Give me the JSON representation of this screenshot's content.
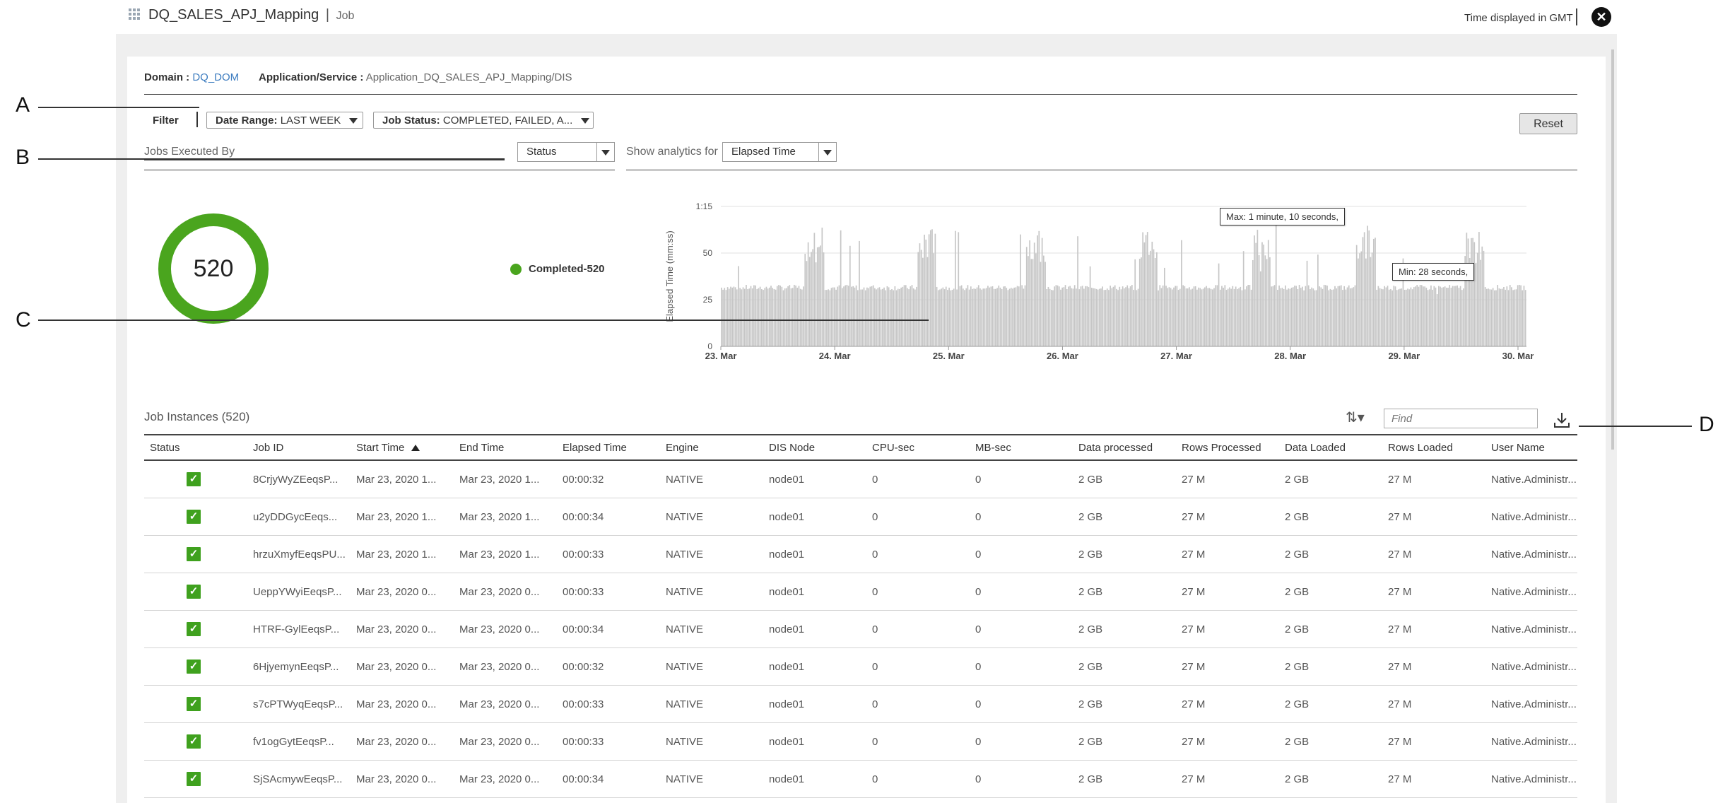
{
  "header": {
    "title": "DQ_SALES_APJ_Mapping",
    "separator": "|",
    "subtitle": "Job",
    "time_note": "Time displayed in GMT",
    "close_icon": "close-icon"
  },
  "domain_row": {
    "domain_label": "Domain :",
    "domain_value": "DQ_DOM",
    "app_label": "Application/Service :",
    "app_value": "Application_DQ_SALES_APJ_Mapping/DIS"
  },
  "filter": {
    "label": "Filter",
    "date_range_label": "Date Range:",
    "date_range_value": "LAST WEEK",
    "job_status_label": "Job Status:",
    "job_status_value": "COMPLETED, FAILED, A...",
    "reset_label": "Reset"
  },
  "jobs_executed": {
    "label": "Jobs Executed By",
    "group_by": "Status",
    "analytics_label": "Show analytics for",
    "analytics_value": "Elapsed Time"
  },
  "donut": {
    "total": "520",
    "legend": "Completed-520",
    "color": "#4aa51e"
  },
  "chart_data": {
    "type": "bar",
    "ylabel": "Elapsed Time (mm:ss)",
    "yticks": [
      "0",
      "25",
      "50",
      "1:15"
    ],
    "ylim": [
      0,
      75
    ],
    "xticks": [
      "23. Mar",
      "24. Mar",
      "25. Mar",
      "26. Mar",
      "27. Mar",
      "28. Mar",
      "29. Mar",
      "30. Mar"
    ],
    "bar_count": 520,
    "baseline_seconds": 32,
    "max_seconds": 70,
    "min_seconds": 28,
    "tooltip_max": "Max: 1 minute, 10 seconds,",
    "tooltip_min": "Min: 28 seconds,",
    "bar_color": "#c6c6c6",
    "grid": true
  },
  "annotations": [
    "A",
    "B",
    "C",
    "D"
  ],
  "jobs": {
    "title": "Job Instances (520)",
    "find_placeholder": "Find",
    "columns": [
      "Status",
      "Job ID",
      "Start Time",
      "End Time",
      "Elapsed Time",
      "Engine",
      "DIS Node",
      "CPU-sec",
      "MB-sec",
      "Data processed",
      "Rows Processed",
      "Data Loaded",
      "Rows Loaded",
      "User Name"
    ],
    "rows": [
      [
        "8CrjyWyZEeqsP...",
        "Mar 23, 2020 1...",
        "Mar 23, 2020 1...",
        "00:00:32",
        "NATIVE",
        "node01",
        "0",
        "0",
        "2 GB",
        "27 M",
        "2 GB",
        "27 M",
        "Native.Administr..."
      ],
      [
        "u2yDDGycEeqs...",
        "Mar 23, 2020 1...",
        "Mar 23, 2020 1...",
        "00:00:34",
        "NATIVE",
        "node01",
        "0",
        "0",
        "2 GB",
        "27 M",
        "2 GB",
        "27 M",
        "Native.Administr..."
      ],
      [
        "hrzuXmyfEeqsPU...",
        "Mar 23, 2020 1...",
        "Mar 23, 2020 1...",
        "00:00:33",
        "NATIVE",
        "node01",
        "0",
        "0",
        "2 GB",
        "27 M",
        "2 GB",
        "27 M",
        "Native.Administr..."
      ],
      [
        "UeppYWyiEeqsP...",
        "Mar 23, 2020 0...",
        "Mar 23, 2020 0...",
        "00:00:33",
        "NATIVE",
        "node01",
        "0",
        "0",
        "2 GB",
        "27 M",
        "2 GB",
        "27 M",
        "Native.Administr..."
      ],
      [
        "HTRF-GylEeqsP...",
        "Mar 23, 2020 0...",
        "Mar 23, 2020 0...",
        "00:00:34",
        "NATIVE",
        "node01",
        "0",
        "0",
        "2 GB",
        "27 M",
        "2 GB",
        "27 M",
        "Native.Administr..."
      ],
      [
        "6HjyemynEeqsP...",
        "Mar 23, 2020 0...",
        "Mar 23, 2020 0...",
        "00:00:32",
        "NATIVE",
        "node01",
        "0",
        "0",
        "2 GB",
        "27 M",
        "2 GB",
        "27 M",
        "Native.Administr..."
      ],
      [
        "s7cPTWyqEeqsP...",
        "Mar 23, 2020 0...",
        "Mar 23, 2020 0...",
        "00:00:33",
        "NATIVE",
        "node01",
        "0",
        "0",
        "2 GB",
        "27 M",
        "2 GB",
        "27 M",
        "Native.Administr..."
      ],
      [
        "fv1ogGytEeqsP...",
        "Mar 23, 2020 0...",
        "Mar 23, 2020 0...",
        "00:00:33",
        "NATIVE",
        "node01",
        "0",
        "0",
        "2 GB",
        "27 M",
        "2 GB",
        "27 M",
        "Native.Administr..."
      ],
      [
        "SjSAcmywEeqsP...",
        "Mar 23, 2020 0...",
        "Mar 23, 2020 0...",
        "00:00:34",
        "NATIVE",
        "node01",
        "0",
        "0",
        "2 GB",
        "27 M",
        "2 GB",
        "27 M",
        "Native.Administr..."
      ]
    ]
  }
}
